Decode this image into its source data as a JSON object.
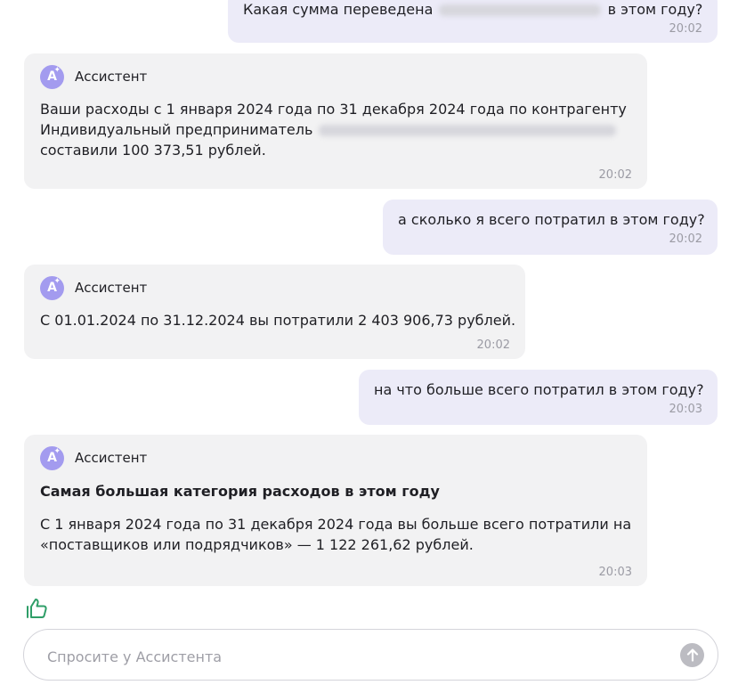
{
  "messages": {
    "m1": {
      "text_before": "Какая сумма переведена",
      "text_after": "в этом году?",
      "time": "20:02"
    },
    "m2": {
      "name": "Ассистент",
      "line1": "Ваши расходы с 1 января 2024 года по 31 декабря 2024 года по контрагенту",
      "line2": "Индивидуальный предприниматель",
      "line3": "составили 100 373,51 рублей.",
      "time": "20:02"
    },
    "m3": {
      "text": "а сколько я всего потратил в этом году?",
      "time": "20:02"
    },
    "m4": {
      "name": "Ассистент",
      "text": "С 01.01.2024 по 31.12.2024 вы потратили 2 403 906,73 рублей.",
      "time": "20:02"
    },
    "m5": {
      "text": "на что больше всего потратил в этом году?",
      "time": "20:03"
    },
    "m6": {
      "name": "Ассистент",
      "heading": "Самая большая категория расходов в этом году",
      "line1": "С 1 января 2024 года по 31 декабря 2024 года вы больше всего потратили на",
      "line2": "«поставщиков или подрядчиков» — 1 122 261,62 рублей.",
      "time": "20:03"
    }
  },
  "composer": {
    "placeholder": "Спросите у Ассистента"
  },
  "icons": {
    "avatar": "assistant-avatar-icon",
    "like": "thumbs-up-icon",
    "send": "arrow-up-icon"
  },
  "colors": {
    "user_bubble": "#ecebf8",
    "assistant_bubble": "#f2f2f3",
    "avatar": "#a39bef",
    "like": "#2f9e68",
    "send": "#bcbcc2"
  }
}
